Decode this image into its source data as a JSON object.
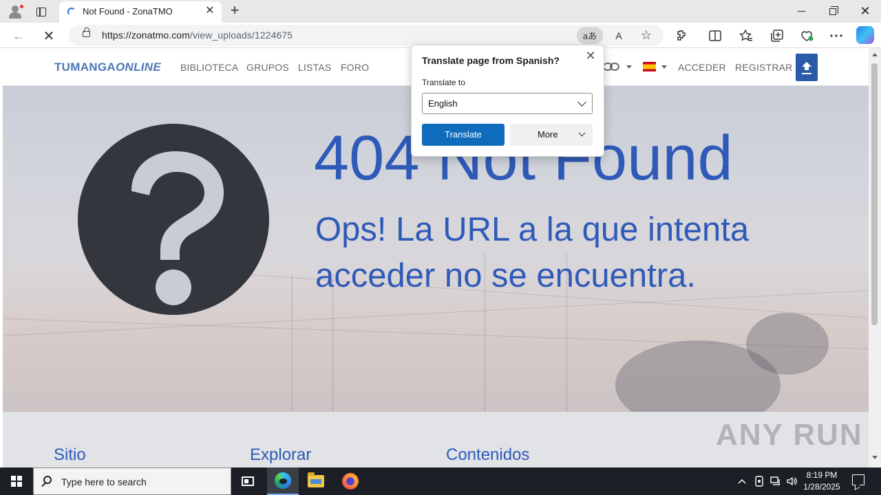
{
  "browser": {
    "tab": {
      "title": "Not Found - ZonaTMO",
      "close_glyph": "✕"
    },
    "new_tab_glyph": "+",
    "window_close_glyph": "✕",
    "address": {
      "url_host": "https://zonatmo.com",
      "url_path": "/view_uploads/1224675"
    },
    "translate_icon_glyph": "aあ",
    "read_aloud_glyph": "A",
    "favorite_glyph": "☆",
    "back_glyph": "←",
    "stop_glyph": "✕"
  },
  "site": {
    "logo_main": "TUMANGA",
    "logo_accent": "ONLINE",
    "nav": [
      "BIBLIOTECA",
      "GRUPOS",
      "LISTAS",
      "FORO"
    ],
    "login": "ACCEDER",
    "register": "REGISTRAR",
    "error_title": "404 Not Found",
    "error_message": "Ops! La URL a la que intenta acceder no se encuentra.",
    "footer_columns": [
      "Sitio",
      "Explorar",
      "Contenidos"
    ]
  },
  "translate_popup": {
    "title": "Translate page from Spanish?",
    "label": "Translate to",
    "selected_language": "English",
    "translate_button": "Translate",
    "more_button": "More",
    "close_glyph": "✕"
  },
  "watermark": "ANY RUN",
  "taskbar": {
    "search_placeholder": "Type here to search",
    "time": "8:19 PM",
    "date": "1/28/2025"
  },
  "colors": {
    "accent_blue": "#2f5ab8",
    "translate_button": "#0f6cbd",
    "taskbar": "#1c2026"
  }
}
